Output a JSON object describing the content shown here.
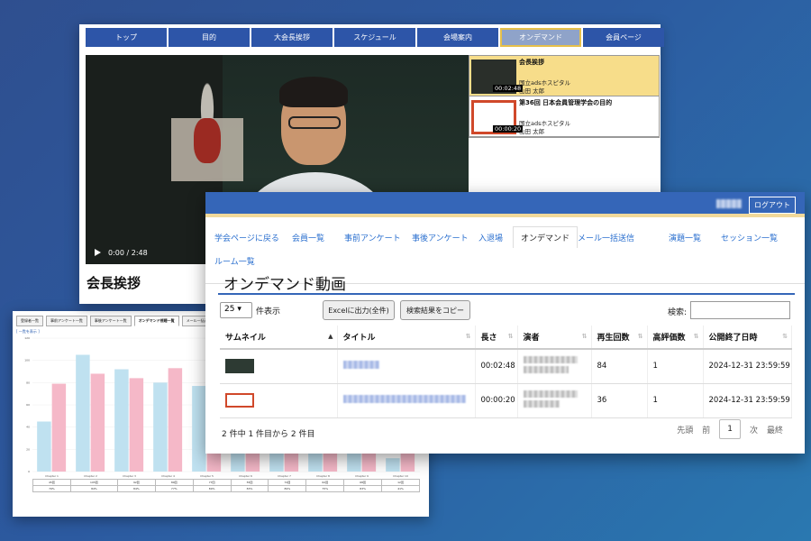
{
  "chart_window": {
    "tabs": [
      "登録者一覧",
      "事前アンケート一覧",
      "事後アンケート一覧",
      "オンデマンド視聴一覧",
      "メール一括送信"
    ],
    "link": "[ 一覧を表示 ]",
    "chart_data": {
      "type": "bar",
      "categories": [
        "Chapter 1",
        "Chapter 2",
        "Chapter 3",
        "Chapter 4",
        "Chapter 5",
        "Chapter 6",
        "Chapter 7",
        "Chapter 8",
        "Chapter 9",
        "Chapter 10"
      ],
      "series": [
        {
          "values": [
            45,
            105,
            92,
            80,
            77,
            55,
            74,
            62,
            68,
            12
          ],
          "color": "#bfe1f0"
        },
        {
          "values": [
            79,
            88,
            84,
            93,
            89,
            70,
            86,
            80,
            74,
            28
          ],
          "color": "#f5b8c8"
        }
      ],
      "ylim": [
        0,
        120
      ],
      "yticks": [
        0,
        20,
        40,
        60,
        80,
        100,
        120
      ],
      "table_row1": [
        "45回",
        "105回",
        "92回",
        "80回",
        "77回",
        "55回",
        "74回",
        "62回",
        "68回",
        "12回"
      ],
      "table_row2": [
        "79%",
        "84%",
        "84%",
        "77%",
        "89%",
        "83%",
        "89%",
        "75%",
        "83%",
        "41%"
      ]
    }
  },
  "video_window": {
    "nav": [
      "トップ",
      "目的",
      "大会長挨拶",
      "スケジュール",
      "会場案内",
      "オンデマンド",
      "会員ページ"
    ],
    "time": "0:00 / 2:48",
    "title": "会長挨拶",
    "playlist": [
      {
        "title": "会長挨拶",
        "org": "国立adsホスピタル",
        "name": "山田 太郎",
        "duration": "00:02:48"
      },
      {
        "title": "第36回 日本会員管理学会の目的",
        "org": "国立adsホスピタル",
        "name": "山田 太郎",
        "duration": "00:00:20"
      }
    ]
  },
  "admin": {
    "logout": "ログアウト",
    "tabs": [
      "学会ページに戻る",
      "会員一覧",
      "事前アンケート",
      "事後アンケート",
      "入退場",
      "オンデマンド",
      "メール一括送信",
      "演題一覧",
      "セッション一覧",
      "ルーム一覧"
    ],
    "page_title": "オンデマンド動画",
    "page_length": "25",
    "page_length_label": "件表示",
    "excel_button": "Excelに出力(全件)",
    "copy_button": "検索結果をコピー",
    "search_label": "検索:",
    "columns": [
      "サムネイル",
      "タイトル",
      "長さ",
      "演者",
      "再生回数",
      "高評価数",
      "公開終了日時"
    ],
    "rows": [
      {
        "length": "00:02:48",
        "plays": "84",
        "likes": "1",
        "end": "2024-12-31 23:59:59"
      },
      {
        "length": "00:00:20",
        "plays": "36",
        "likes": "1",
        "end": "2024-12-31 23:59:59"
      }
    ],
    "summary": "2 件中 1 件目から 2 件目",
    "pager": {
      "first": "先頭",
      "prev": "前",
      "current": "1",
      "next": "次",
      "last": "最終"
    }
  }
}
